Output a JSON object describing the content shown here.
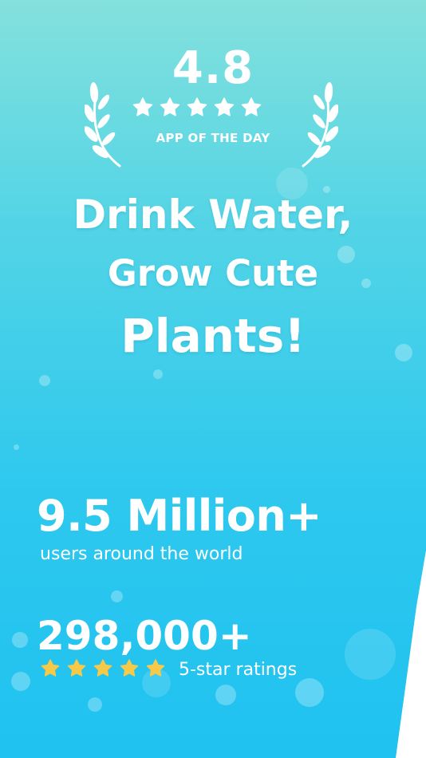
{
  "award": {
    "rating": "4.8",
    "stars": 5,
    "caption": "APP OF THE DAY",
    "star_color": "#ffffff"
  },
  "headline": {
    "line1": "Drink Water,",
    "line2": "Grow Cute",
    "line3": "Plants!"
  },
  "stats": {
    "users": {
      "value": "9.5  Million+",
      "caption": "users around the world"
    },
    "ratings": {
      "value": "298,000+",
      "stars": 5,
      "star_color": "#f7c948",
      "caption": "5-star ratings"
    }
  },
  "colors": {
    "background_top": "#84e1dc",
    "background_bottom": "#1fc2f0",
    "text": "#ffffff"
  }
}
